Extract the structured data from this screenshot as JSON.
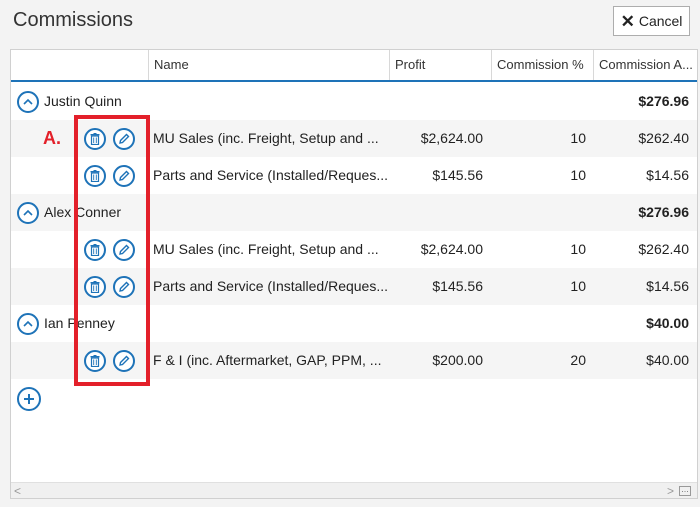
{
  "dialog": {
    "title": "Commissions",
    "cancel_label": "Cancel"
  },
  "columns": [
    "Name",
    "Profit",
    "Commission %",
    "Commission A..."
  ],
  "groups": [
    {
      "person": "Justin Quinn",
      "total": "$276.96",
      "items": [
        {
          "name": "MU Sales (inc. Freight, Setup and ...",
          "profit": "$2,624.00",
          "pct": "10",
          "amount": "$262.40"
        },
        {
          "name": "Parts and Service (Installed/Reques...",
          "profit": "$145.56",
          "pct": "10",
          "amount": "$14.56"
        }
      ]
    },
    {
      "person": "Alex Conner",
      "total": "$276.96",
      "items": [
        {
          "name": "MU Sales (inc. Freight, Setup and ...",
          "profit": "$2,624.00",
          "pct": "10",
          "amount": "$262.40"
        },
        {
          "name": "Parts and Service (Installed/Reques...",
          "profit": "$145.56",
          "pct": "10",
          "amount": "$14.56"
        }
      ]
    },
    {
      "person": "Ian Penney",
      "total": "$40.00",
      "items": [
        {
          "name": "F & I (inc. Aftermarket, GAP, PPM, ...",
          "profit": "$200.00",
          "pct": "20",
          "amount": "$40.00"
        }
      ]
    }
  ],
  "annotation": {
    "label": "A.",
    "color": "#e3202a"
  },
  "colors": {
    "accent": "#1e73b8",
    "alt_row": "#f5f5f5"
  },
  "icons": {
    "delete": "trash-icon",
    "edit": "pencil-icon",
    "collapse": "chevron-up-icon",
    "add": "plus-icon",
    "close": "x-icon"
  }
}
